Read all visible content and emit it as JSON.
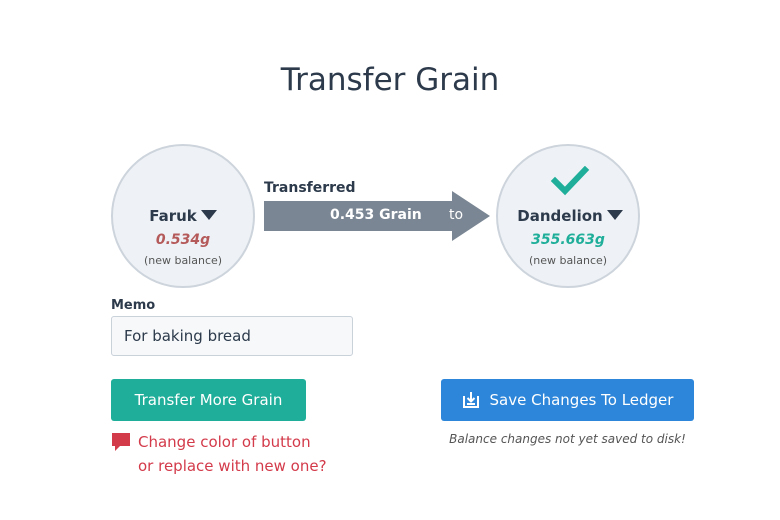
{
  "page": {
    "title": "Transfer Grain"
  },
  "from": {
    "name": "Faruk",
    "balance": "0.534g",
    "note": "(new balance)"
  },
  "to": {
    "name": "Dandelion",
    "balance": "355.663g",
    "note": "(new balance)",
    "status_icon": "check-icon"
  },
  "transfer": {
    "label": "Transferred",
    "amount": "0.453 Grain",
    "to_word": "to"
  },
  "memo": {
    "label": "Memo",
    "value": "For baking bread"
  },
  "buttons": {
    "more": "Transfer More Grain",
    "save": "Save Changes To Ledger"
  },
  "comment": {
    "line1": "Change color of button",
    "line2": "or replace with new one?"
  },
  "warning": "Balance changes not yet saved to disk!",
  "colors": {
    "teal": "#1fae99",
    "blue": "#2d86d9",
    "arrow": "#7a8693",
    "red_text": "#d33a4a",
    "red_balance": "#b55a5a"
  }
}
